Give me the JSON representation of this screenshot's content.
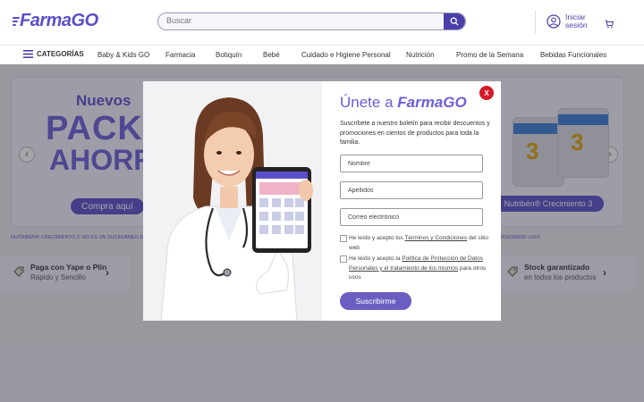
{
  "brand": {
    "name_part1": "Farma",
    "name_part2": "GO",
    "accent": "#5a4fc8"
  },
  "search": {
    "placeholder": "Buscar"
  },
  "account": {
    "login_label": "Iniciar sesión"
  },
  "nav": {
    "categories_label": "CATEGORÍAS",
    "items": [
      "Baby & Kids GO",
      "Farmacia",
      "Botiquín",
      "Bebé",
      "Cuidado e Higiene Personal",
      "Nutrición",
      "Promo de la Semana",
      "Bebidas Funcionales"
    ]
  },
  "banner": {
    "headline_1": "Nuevos",
    "headline_2": "PACK",
    "headline_3": "AHORR",
    "cta": "Compra aquí",
    "product_brand": "Nutribén",
    "product_label": "Nutribén® Crecimiento 3",
    "product_number": "3",
    "disclaimer_left": "NUTRIBÉN® CRECIMIENTO 3. NO ES UN SUCEDÁNEO DE LA LE",
    "disclaimer_right": "R16005630 v10.0"
  },
  "info_cards": [
    {
      "title": "Paga con Yape o Plin",
      "subtitle": "Rápido y Sencillo"
    },
    {
      "title": "Stock garantizado",
      "subtitle": "en todos los productos"
    }
  ],
  "modal": {
    "title_prefix": "Únete a ",
    "title_brand": "FarmaGO",
    "description": "Suscríbete a nuestro boletín para recibir descuentos y promociones en cientos de productos para toda la familia.",
    "fields": {
      "first_name": "Nombre",
      "last_name": "Apellidos",
      "email": "Correo electrónico"
    },
    "terms_pre": "He leído y acepto los ",
    "terms_link": "Términos y Condiciones",
    "terms_post": " del sitio web",
    "privacy_pre": "He leído y acepto la ",
    "privacy_link": "Política de Protección de Datos Personales y el tratamiento de los mismos",
    "privacy_post": " para otros usos",
    "submit_label": "Suscribirme",
    "close_label": "X",
    "close_color": "#d51a2a"
  }
}
